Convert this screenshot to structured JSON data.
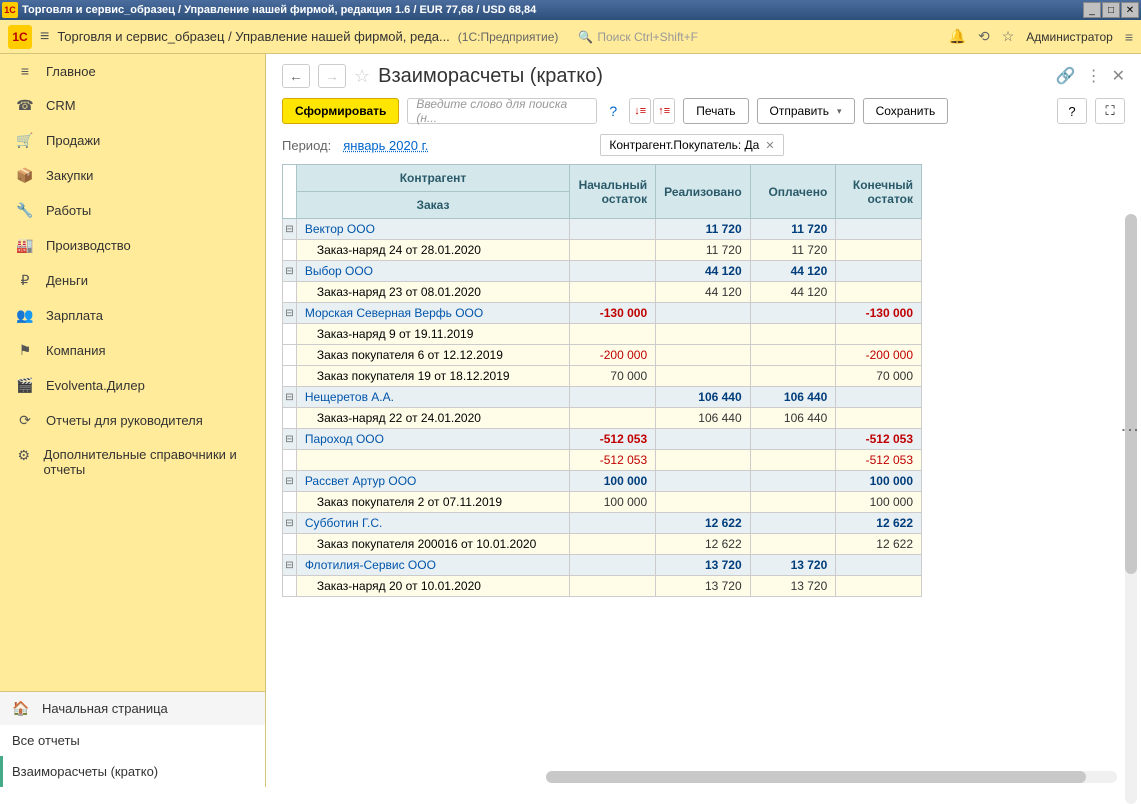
{
  "titlebar": "Торговля и сервис_образец / Управление нашей фирмой, редакция 1.6 / EUR 77,68 / USD 68,84",
  "topnav": {
    "crumbs": "Торговля и сервис_образец / Управление нашей фирмой, реда...",
    "mode": "(1С:Предприятие)",
    "search_placeholder": "Поиск Ctrl+Shift+F",
    "user": "Администратор"
  },
  "sidebar": {
    "items": [
      {
        "icon": "≡",
        "label": "Главное"
      },
      {
        "icon": "☎",
        "label": "CRM"
      },
      {
        "icon": "🛒",
        "label": "Продажи"
      },
      {
        "icon": "📦",
        "label": "Закупки"
      },
      {
        "icon": "🔧",
        "label": "Работы"
      },
      {
        "icon": "🏭",
        "label": "Производство"
      },
      {
        "icon": "₽",
        "label": "Деньги"
      },
      {
        "icon": "👥",
        "label": "Зарплата"
      },
      {
        "icon": "⚑",
        "label": "Компания"
      },
      {
        "icon": "🎬",
        "label": "Evolventa.Дилер"
      },
      {
        "icon": "⟳",
        "label": "Отчеты для руководителя"
      },
      {
        "icon": "⚙",
        "label": "Дополнительные справочники и отчеты"
      }
    ],
    "bottom": [
      {
        "icon": "🏠",
        "label": "Начальная страница"
      },
      {
        "icon": "",
        "label": "Все отчеты"
      },
      {
        "icon": "",
        "label": "Взаиморасчеты (кратко)"
      }
    ]
  },
  "page": {
    "title": "Взаиморасчеты (кратко)"
  },
  "toolbar": {
    "form": "Сформировать",
    "search_placeholder": "Введите слово для поиска (н...",
    "print": "Печать",
    "send": "Отправить",
    "save": "Сохранить"
  },
  "filter": {
    "period_label": "Период:",
    "period_value": "январь 2020 г.",
    "tag": "Контрагент.Покупатель: Да"
  },
  "table": {
    "headers": {
      "contragent": "Контрагент",
      "order": "Заказ",
      "start_balance": "Начальный остаток",
      "realized": "Реализовано",
      "paid": "Оплачено",
      "end_balance": "Конечный остаток"
    },
    "rows": [
      {
        "type": "group",
        "name": "Вектор ООО",
        "start": "",
        "real": "11 720",
        "paid": "11 720",
        "end": ""
      },
      {
        "type": "detail",
        "name": "Заказ-наряд 24 от 28.01.2020",
        "start": "",
        "real": "11 720",
        "paid": "11 720",
        "end": ""
      },
      {
        "type": "group",
        "name": "Выбор ООО",
        "start": "",
        "real": "44 120",
        "paid": "44 120",
        "end": ""
      },
      {
        "type": "detail",
        "name": "Заказ-наряд 23 от 08.01.2020",
        "start": "",
        "real": "44 120",
        "paid": "44 120",
        "end": ""
      },
      {
        "type": "group",
        "name": "Морская Северная Верфь ООО",
        "start": "-130 000",
        "real": "",
        "paid": "",
        "end": "-130 000",
        "neg": true
      },
      {
        "type": "detail",
        "name": "Заказ-наряд 9 от 19.11.2019",
        "start": "",
        "real": "",
        "paid": "",
        "end": ""
      },
      {
        "type": "detail",
        "name": "Заказ покупателя 6 от 12.12.2019",
        "start": "-200 000",
        "real": "",
        "paid": "",
        "end": "-200 000",
        "neg": true
      },
      {
        "type": "detail",
        "name": "Заказ покупателя 19 от 18.12.2019",
        "start": "70 000",
        "real": "",
        "paid": "",
        "end": "70 000"
      },
      {
        "type": "group",
        "name": "Нещеретов А.А.",
        "start": "",
        "real": "106 440",
        "paid": "106 440",
        "end": ""
      },
      {
        "type": "detail",
        "name": "Заказ-наряд 22 от 24.01.2020",
        "start": "",
        "real": "106 440",
        "paid": "106 440",
        "end": ""
      },
      {
        "type": "group",
        "name": "Пароход ООО",
        "start": "-512 053",
        "real": "",
        "paid": "",
        "end": "-512 053",
        "neg": true
      },
      {
        "type": "detail",
        "name": "",
        "start": "-512 053",
        "real": "",
        "paid": "",
        "end": "-512 053",
        "neg": true
      },
      {
        "type": "group",
        "name": "Рассвет Артур ООО",
        "start": "100 000",
        "real": "",
        "paid": "",
        "end": "100 000"
      },
      {
        "type": "detail",
        "name": "Заказ покупателя 2 от 07.11.2019",
        "start": "100 000",
        "real": "",
        "paid": "",
        "end": "100 000"
      },
      {
        "type": "group",
        "name": "Субботин Г.С.",
        "start": "",
        "real": "12 622",
        "paid": "",
        "end": "12 622"
      },
      {
        "type": "detail",
        "name": "Заказ покупателя 200016 от 10.01.2020",
        "start": "",
        "real": "12 622",
        "paid": "",
        "end": "12 622"
      },
      {
        "type": "group",
        "name": "Флотилия-Сервис ООО",
        "start": "",
        "real": "13 720",
        "paid": "13 720",
        "end": ""
      },
      {
        "type": "detail",
        "name": "Заказ-наряд 20 от 10.01.2020",
        "start": "",
        "real": "13 720",
        "paid": "13 720",
        "end": ""
      }
    ]
  }
}
